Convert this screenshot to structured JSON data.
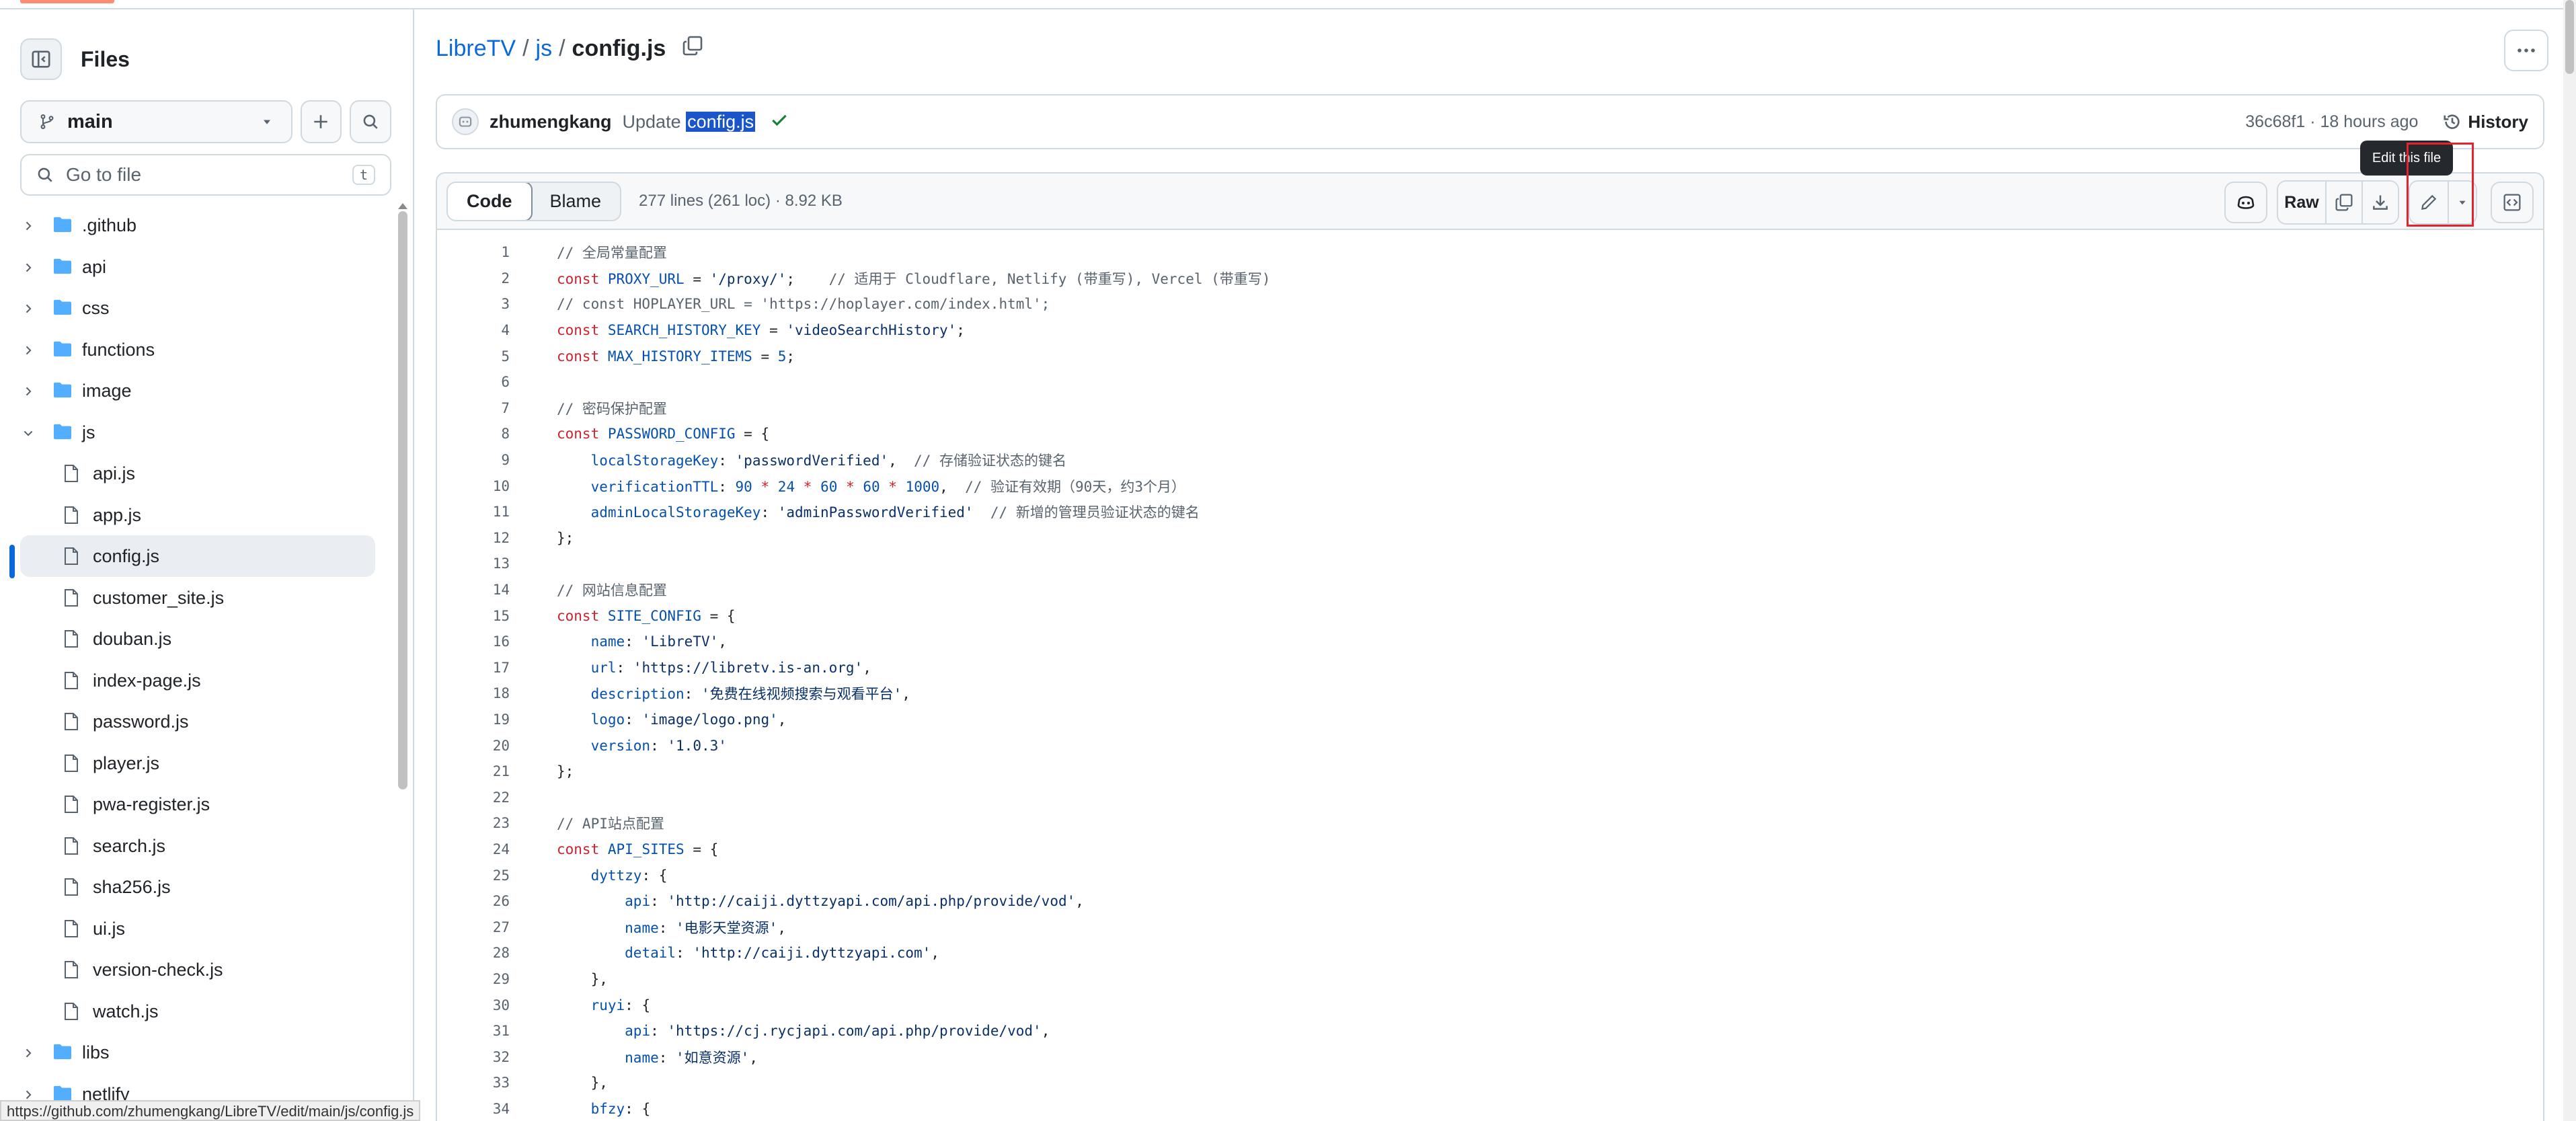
{
  "colors": {
    "link": "#0969da",
    "keyword": "#cf222e",
    "identifier": "#0550ae",
    "string": "#0a3069",
    "comment": "#59636e",
    "highlight": "#e5232f"
  },
  "sidebar": {
    "title": "Files",
    "branch": "main",
    "goto_placeholder": "Go to file",
    "goto_shortcut": "t",
    "tree": [
      {
        "name": ".github",
        "type": "folder",
        "expanded": false,
        "depth": 0
      },
      {
        "name": "api",
        "type": "folder",
        "expanded": false,
        "depth": 0
      },
      {
        "name": "css",
        "type": "folder",
        "expanded": false,
        "depth": 0
      },
      {
        "name": "functions",
        "type": "folder",
        "expanded": false,
        "depth": 0
      },
      {
        "name": "image",
        "type": "folder",
        "expanded": false,
        "depth": 0
      },
      {
        "name": "js",
        "type": "folder",
        "expanded": true,
        "depth": 0
      },
      {
        "name": "api.js",
        "type": "file",
        "depth": 1
      },
      {
        "name": "app.js",
        "type": "file",
        "depth": 1
      },
      {
        "name": "config.js",
        "type": "file",
        "depth": 1,
        "active": true
      },
      {
        "name": "customer_site.js",
        "type": "file",
        "depth": 1
      },
      {
        "name": "douban.js",
        "type": "file",
        "depth": 1
      },
      {
        "name": "index-page.js",
        "type": "file",
        "depth": 1
      },
      {
        "name": "password.js",
        "type": "file",
        "depth": 1
      },
      {
        "name": "player.js",
        "type": "file",
        "depth": 1
      },
      {
        "name": "pwa-register.js",
        "type": "file",
        "depth": 1
      },
      {
        "name": "search.js",
        "type": "file",
        "depth": 1
      },
      {
        "name": "sha256.js",
        "type": "file",
        "depth": 1
      },
      {
        "name": "ui.js",
        "type": "file",
        "depth": 1
      },
      {
        "name": "version-check.js",
        "type": "file",
        "depth": 1
      },
      {
        "name": "watch.js",
        "type": "file",
        "depth": 1
      },
      {
        "name": "libs",
        "type": "folder",
        "expanded": false,
        "depth": 0
      },
      {
        "name": "netlify",
        "type": "folder",
        "expanded": false,
        "depth": 0
      }
    ]
  },
  "status_url": "https://github.com/zhumengkang/LibreTV/edit/main/js/config.js",
  "breadcrumb": {
    "repo": "LibreTV",
    "sep1": "/",
    "dir": "js",
    "sep2": "/",
    "file": "config.js"
  },
  "commit": {
    "author": "zhumengkang",
    "message_prefix": "Update",
    "message_file": "config.js",
    "meta": "36c68f1 · 18 hours ago",
    "history_label": "History"
  },
  "file_header": {
    "tab_code": "Code",
    "tab_blame": "Blame",
    "info": "277 lines (261 loc) · 8.92 KB",
    "raw_label": "Raw",
    "tooltip": "Edit this file"
  },
  "code_lines": [
    [
      [
        "c",
        "// 全局常量配置"
      ]
    ],
    [
      [
        "k",
        "const"
      ],
      [
        "p",
        " "
      ],
      [
        "i",
        "PROXY_URL"
      ],
      [
        "p",
        " = "
      ],
      [
        "s",
        "'/proxy/'"
      ],
      [
        "p",
        ";    "
      ],
      [
        "c",
        "// 适用于 Cloudflare, Netlify (带重写), Vercel (带重写)"
      ]
    ],
    [
      [
        "c",
        "// const HOPLAYER_URL = 'https://hoplayer.com/index.html';"
      ]
    ],
    [
      [
        "k",
        "const"
      ],
      [
        "p",
        " "
      ],
      [
        "i",
        "SEARCH_HISTORY_KEY"
      ],
      [
        "p",
        " = "
      ],
      [
        "s",
        "'videoSearchHistory'"
      ],
      [
        "p",
        ";"
      ]
    ],
    [
      [
        "k",
        "const"
      ],
      [
        "p",
        " "
      ],
      [
        "i",
        "MAX_HISTORY_ITEMS"
      ],
      [
        "p",
        " = "
      ],
      [
        "i",
        "5"
      ],
      [
        "p",
        ";"
      ]
    ],
    [
      [
        "p",
        ""
      ]
    ],
    [
      [
        "c",
        "// 密码保护配置"
      ]
    ],
    [
      [
        "k",
        "const"
      ],
      [
        "p",
        " "
      ],
      [
        "i",
        "PASSWORD_CONFIG"
      ],
      [
        "p",
        " = {"
      ]
    ],
    [
      [
        "p",
        "    "
      ],
      [
        "i",
        "localStorageKey"
      ],
      [
        "p",
        ": "
      ],
      [
        "s",
        "'passwordVerified'"
      ],
      [
        "p",
        ",  "
      ],
      [
        "c",
        "// 存储验证状态的键名"
      ]
    ],
    [
      [
        "p",
        "    "
      ],
      [
        "i",
        "verificationTTL"
      ],
      [
        "p",
        ": "
      ],
      [
        "i",
        "90"
      ],
      [
        "p",
        " "
      ],
      [
        "k",
        "*"
      ],
      [
        "p",
        " "
      ],
      [
        "i",
        "24"
      ],
      [
        "p",
        " "
      ],
      [
        "k",
        "*"
      ],
      [
        "p",
        " "
      ],
      [
        "i",
        "60"
      ],
      [
        "p",
        " "
      ],
      [
        "k",
        "*"
      ],
      [
        "p",
        " "
      ],
      [
        "i",
        "60"
      ],
      [
        "p",
        " "
      ],
      [
        "k",
        "*"
      ],
      [
        "p",
        " "
      ],
      [
        "i",
        "1000"
      ],
      [
        "p",
        ",  "
      ],
      [
        "c",
        "// 验证有效期（90天，约3个月）"
      ]
    ],
    [
      [
        "p",
        "    "
      ],
      [
        "i",
        "adminLocalStorageKey"
      ],
      [
        "p",
        ": "
      ],
      [
        "s",
        "'adminPasswordVerified'"
      ],
      [
        "p",
        "  "
      ],
      [
        "c",
        "// 新增的管理员验证状态的键名"
      ]
    ],
    [
      [
        "p",
        "};"
      ]
    ],
    [
      [
        "p",
        ""
      ]
    ],
    [
      [
        "c",
        "// 网站信息配置"
      ]
    ],
    [
      [
        "k",
        "const"
      ],
      [
        "p",
        " "
      ],
      [
        "i",
        "SITE_CONFIG"
      ],
      [
        "p",
        " = {"
      ]
    ],
    [
      [
        "p",
        "    "
      ],
      [
        "i",
        "name"
      ],
      [
        "p",
        ": "
      ],
      [
        "s",
        "'LibreTV'"
      ],
      [
        "p",
        ","
      ]
    ],
    [
      [
        "p",
        "    "
      ],
      [
        "i",
        "url"
      ],
      [
        "p",
        ": "
      ],
      [
        "s",
        "'https://libretv.is-an.org'"
      ],
      [
        "p",
        ","
      ]
    ],
    [
      [
        "p",
        "    "
      ],
      [
        "i",
        "description"
      ],
      [
        "p",
        ": "
      ],
      [
        "s",
        "'免费在线视频搜索与观看平台'"
      ],
      [
        "p",
        ","
      ]
    ],
    [
      [
        "p",
        "    "
      ],
      [
        "i",
        "logo"
      ],
      [
        "p",
        ": "
      ],
      [
        "s",
        "'image/logo.png'"
      ],
      [
        "p",
        ","
      ]
    ],
    [
      [
        "p",
        "    "
      ],
      [
        "i",
        "version"
      ],
      [
        "p",
        ": "
      ],
      [
        "s",
        "'1.0.3'"
      ]
    ],
    [
      [
        "p",
        "};"
      ]
    ],
    [
      [
        "p",
        ""
      ]
    ],
    [
      [
        "c",
        "// API站点配置"
      ]
    ],
    [
      [
        "k",
        "const"
      ],
      [
        "p",
        " "
      ],
      [
        "i",
        "API_SITES"
      ],
      [
        "p",
        " = {"
      ]
    ],
    [
      [
        "p",
        "    "
      ],
      [
        "i",
        "dyttzy"
      ],
      [
        "p",
        ": {"
      ]
    ],
    [
      [
        "p",
        "        "
      ],
      [
        "i",
        "api"
      ],
      [
        "p",
        ": "
      ],
      [
        "s",
        "'http://caiji.dyttzyapi.com/api.php/provide/vod'"
      ],
      [
        "p",
        ","
      ]
    ],
    [
      [
        "p",
        "        "
      ],
      [
        "i",
        "name"
      ],
      [
        "p",
        ": "
      ],
      [
        "s",
        "'电影天堂资源'"
      ],
      [
        "p",
        ","
      ]
    ],
    [
      [
        "p",
        "        "
      ],
      [
        "i",
        "detail"
      ],
      [
        "p",
        ": "
      ],
      [
        "s",
        "'http://caiji.dyttzyapi.com'"
      ],
      [
        "p",
        ","
      ]
    ],
    [
      [
        "p",
        "    },"
      ]
    ],
    [
      [
        "p",
        "    "
      ],
      [
        "i",
        "ruyi"
      ],
      [
        "p",
        ": {"
      ]
    ],
    [
      [
        "p",
        "        "
      ],
      [
        "i",
        "api"
      ],
      [
        "p",
        ": "
      ],
      [
        "s",
        "'https://cj.rycjapi.com/api.php/provide/vod'"
      ],
      [
        "p",
        ","
      ]
    ],
    [
      [
        "p",
        "        "
      ],
      [
        "i",
        "name"
      ],
      [
        "p",
        ": "
      ],
      [
        "s",
        "'如意资源'"
      ],
      [
        "p",
        ","
      ]
    ],
    [
      [
        "p",
        "    },"
      ]
    ],
    [
      [
        "p",
        "    "
      ],
      [
        "i",
        "bfzy"
      ],
      [
        "p",
        ": {"
      ]
    ]
  ]
}
